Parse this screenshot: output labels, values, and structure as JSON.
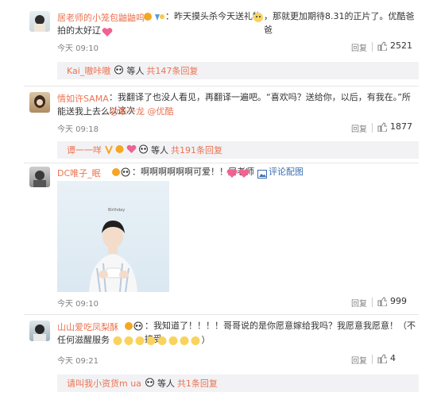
{
  "comments": [
    {
      "username": "居老师的小笼包鼬鼬呜",
      "text_line1": "：昨天摸头杀今天送礼物",
      "text_line1b": "，那就更加期待8.31的正片了。优酷爸爸",
      "text_line2": "拍的太好辽",
      "time": "今天 09:10",
      "reply_label": "回复",
      "likes": "2521",
      "thread": {
        "name": "Kai_嗷咔嗷",
        "suffix": "等人",
        "count": "共147条回复"
      }
    },
    {
      "username": "情如许SAMA",
      "text_line1": "：我翻译了也没人看见，再翻译一遍吧。“喜欢吗？送给你，以后，有我在。”所以这次",
      "text_line2": "能送我上去么",
      "mention1": "@朱一龙",
      "mention2": "@优酷",
      "time": "今天 09:18",
      "reply_label": "回复",
      "likes": "1877",
      "thread": {
        "name": "谭一一咩",
        "suffix": "等人",
        "count": "共191条回复"
      }
    },
    {
      "username": "DC唯子_眠",
      "text_line1": "：啊啊啊啊啊啊可爱！！居老师",
      "tail_link": "评论配图",
      "photo_caption": "Birthday",
      "time": "今天 09:10",
      "reply_label": "回复",
      "likes": "999"
    },
    {
      "username": "山山爱吃凤梨酥",
      "text_line1": "：我知道了！！！！哥哥说的是你愿意嫁给我吗？我愿意我愿意！（不接受",
      "text_line2": "任何滋醒服务",
      "text_line2_end": "）",
      "time": "今天 09:21",
      "reply_label": "回复",
      "likes": "4",
      "thread": {
        "name": "请叫我小资货m ua",
        "suffix": "等人",
        "count": "共1条回复"
      }
    }
  ],
  "colors": {
    "accent": "#eb7350",
    "link": "#3a6fb0",
    "muted": "#808080"
  }
}
